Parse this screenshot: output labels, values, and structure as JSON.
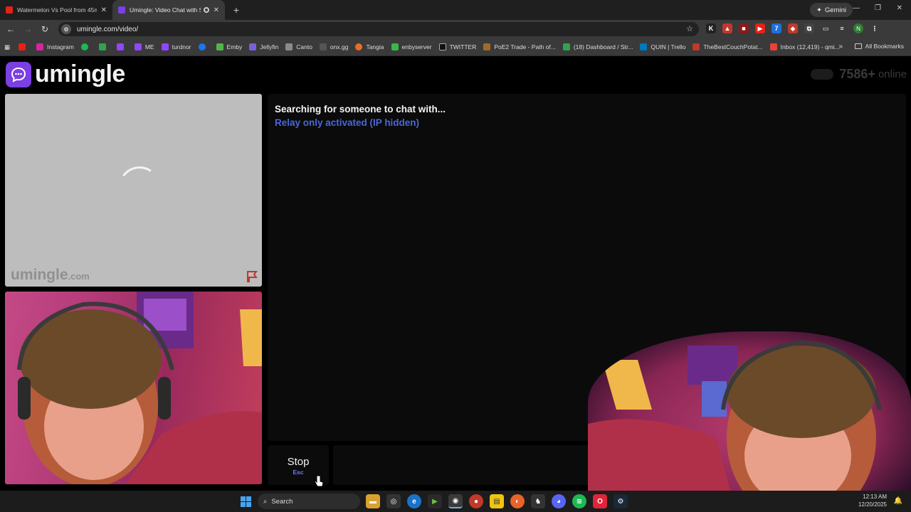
{
  "browser": {
    "tabs": [
      {
        "title": "Watermelon Vs Pool from 45m",
        "active": false,
        "favicon_color": "#e62117"
      },
      {
        "title": "Umingle: Video Chat with S",
        "active": true,
        "favicon_color": "#7b3fe4"
      }
    ],
    "new_tab_label": "+",
    "gemini_label": "Gemini",
    "url": "umingle.com/video/",
    "profile_initial": "N",
    "bookmarks": [
      {
        "label": "",
        "color": "#e62117"
      },
      {
        "label": "Instagram",
        "color": "#d6249f"
      },
      {
        "label": "",
        "color": "#1db954"
      },
      {
        "label": "",
        "color": "#2ea44f"
      },
      {
        "label": "",
        "color": "#9146ff"
      },
      {
        "label": "ME",
        "color": "#9146ff"
      },
      {
        "label": "turdnor",
        "color": "#9146ff"
      },
      {
        "label": "",
        "color": "#1877f2"
      },
      {
        "label": "Emby",
        "color": "#52b54b"
      },
      {
        "label": "Jellyfin",
        "color": "#7c5fd8"
      },
      {
        "label": "Canto",
        "color": "#8a8a8a"
      },
      {
        "label": "onx.gg",
        "color": "#555555"
      },
      {
        "label": "Tangia",
        "color": "#e96d2a"
      },
      {
        "label": "enbyserver",
        "color": "#3ab54a"
      },
      {
        "label": "TWITTER",
        "color": "#111111"
      },
      {
        "label": "PoE2 Trade - Path of...",
        "color": "#a06a2c"
      },
      {
        "label": "(18) Dashboard / Str...",
        "color": "#2ea44f"
      },
      {
        "label": "QUIN | Trello",
        "color": "#0079bf"
      },
      {
        "label": "TheBestCouchPotat...",
        "color": "#c0392b"
      },
      {
        "label": "Inbox (12,419) - qmi...",
        "color": "#ea4335"
      }
    ],
    "all_bookmarks_label": "All Bookmarks"
  },
  "page": {
    "logo_text": "umingle",
    "online_count": "7586+",
    "online_word": "online",
    "remote_watermark": "umingle",
    "remote_watermark_suffix": ".com",
    "status_searching": "Searching for someone to chat with...",
    "status_relay": "Relay only activated (IP hidden)",
    "stop_label": "Stop",
    "stop_key": "Esc",
    "accent_color": "#7b3fe4",
    "relay_color": "#4a67d8"
  },
  "taskbar": {
    "search_label": "Search",
    "time": "12:13 AM",
    "date": "12/20/2025"
  }
}
